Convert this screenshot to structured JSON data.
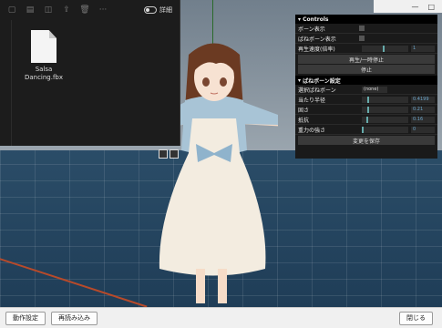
{
  "explorer": {
    "detail_label": "詳細",
    "file_name_line1": "Salsa",
    "file_name_line2": "Dancing.fbx"
  },
  "controls": {
    "header": "Controls",
    "bone_display": "ボーン表示",
    "spring_bone_display": "ばねボーン表示",
    "playback_speed_label": "再生速度(倍率)",
    "playback_speed_value": "1",
    "pause_button": "再生/一時停止",
    "stop_button": "停止"
  },
  "spring": {
    "header": "ばねボーン設定",
    "selected_label": "選択ばねボーン",
    "selected_value": "(none)",
    "hit_radius_label": "当たり半径",
    "hit_radius_value": "0.4199",
    "stiffness_label": "固さ",
    "stiffness_value": "0.21",
    "damping_label": "抵抗",
    "damping_value": "0.16",
    "gravity_label": "重力の強さ",
    "gravity_value": "0",
    "save_button": "変更を保存"
  },
  "bottom": {
    "motion_settings": "動作設定",
    "reload": "再読み込み",
    "close": "閉じる"
  },
  "window": {
    "minimize": "—",
    "maximize": "□"
  }
}
